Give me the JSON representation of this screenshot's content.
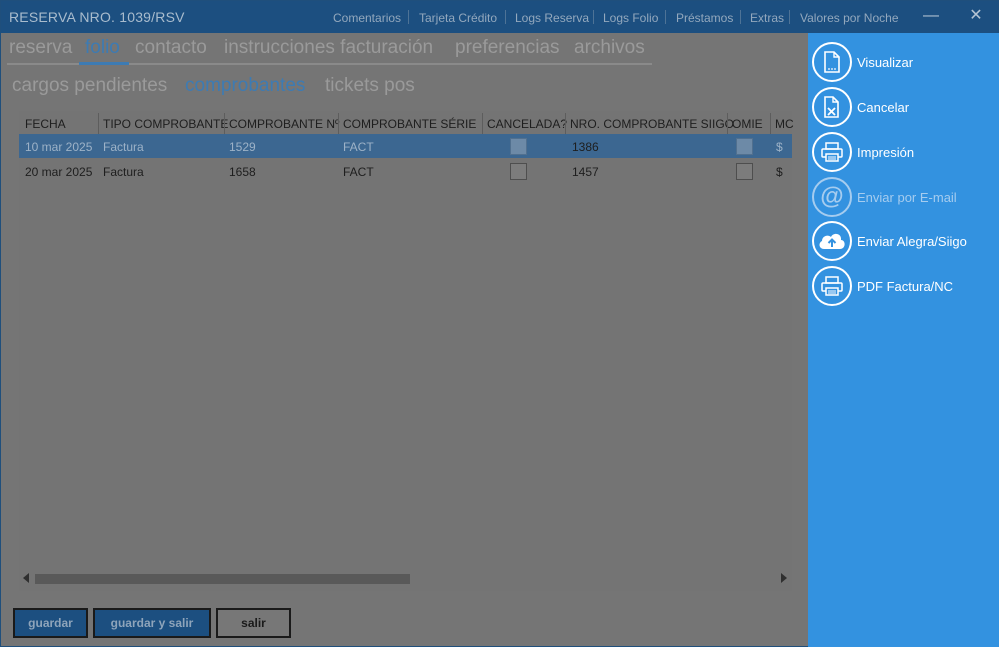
{
  "window": {
    "title": "RESERVA NRO. 1039/RSV",
    "menu": [
      "Comentarios",
      "Tarjeta Crédito",
      "Logs Reserva",
      "Logs Folio",
      "Préstamos",
      "Extras",
      "Valores por Noche"
    ],
    "minimize_glyph": "—",
    "close_glyph": "✕"
  },
  "tabs": [
    "reserva",
    "folio",
    "contacto",
    "instrucciones facturación",
    "preferencias",
    "archivos"
  ],
  "subtabs": [
    "cargos pendientes",
    "comprobantes",
    "tickets pos"
  ],
  "grid": {
    "columns": [
      "FECHA",
      "TIPO COMPROBANTE",
      "COMPROBANTE Nº",
      "COMPROBANTE SÉRIE",
      "CANCELADA?",
      "NRO. COMPROBANTE SIIGO",
      "OMIE",
      "MC"
    ],
    "rows": [
      {
        "fecha": "10 mar 2025",
        "tipo": "Factura",
        "numero": "1529",
        "serie": "FACT",
        "siigo": "1386",
        "moneda": "$"
      },
      {
        "fecha": "20 mar 2025",
        "tipo": "Factura",
        "numero": "1658",
        "serie": "FACT",
        "siigo": "1457",
        "moneda": "$"
      }
    ]
  },
  "buttons": {
    "guardar": "guardar",
    "guardar_salir": "guardar y salir",
    "salir": "salir"
  },
  "actions": [
    {
      "label": "Visualizar",
      "icon": "document-icon",
      "enabled": true
    },
    {
      "label": "Cancelar",
      "icon": "cancel-document-icon",
      "enabled": true
    },
    {
      "label": "Impresión",
      "icon": "printer-icon",
      "enabled": true
    },
    {
      "label": "Enviar por E-mail",
      "icon": "at-sign-icon",
      "at_glyph": "@",
      "enabled": false
    },
    {
      "label": "Enviar Alegra/Siigo",
      "icon": "cloud-upload-icon",
      "enabled": true
    },
    {
      "label": "PDF Factura/NC",
      "icon": "printer-icon",
      "enabled": true
    }
  ],
  "colors": {
    "titlebar": "#1c4f80",
    "accent": "#3d7bb3",
    "panel": "#3392e0",
    "overlay_gray": "#757575"
  }
}
